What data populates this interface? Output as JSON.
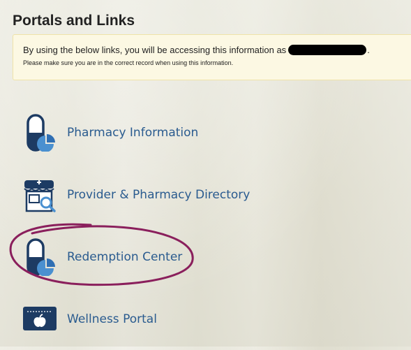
{
  "page": {
    "title": "Portals and Links"
  },
  "notice": {
    "line1": "By using the below links, you will be accessing this information as",
    "line1_end": ".",
    "line2": "Please make sure you are in the correct record when using this information."
  },
  "links": [
    {
      "label": "Pharmacy Information",
      "icon": "pill-chart-icon"
    },
    {
      "label": "Provider & Pharmacy Directory",
      "icon": "clinic-search-icon"
    },
    {
      "label": "Redemption Center",
      "icon": "pill-chart-icon"
    },
    {
      "label": "Wellness Portal",
      "icon": "wellness-card-icon"
    }
  ],
  "colors": {
    "link_text": "#2a5b8f",
    "icon_navy": "#1d3b63",
    "icon_light_blue": "#4a90d0",
    "notice_bg": "#fcf8e3",
    "annotation": "#8a1f5c"
  }
}
